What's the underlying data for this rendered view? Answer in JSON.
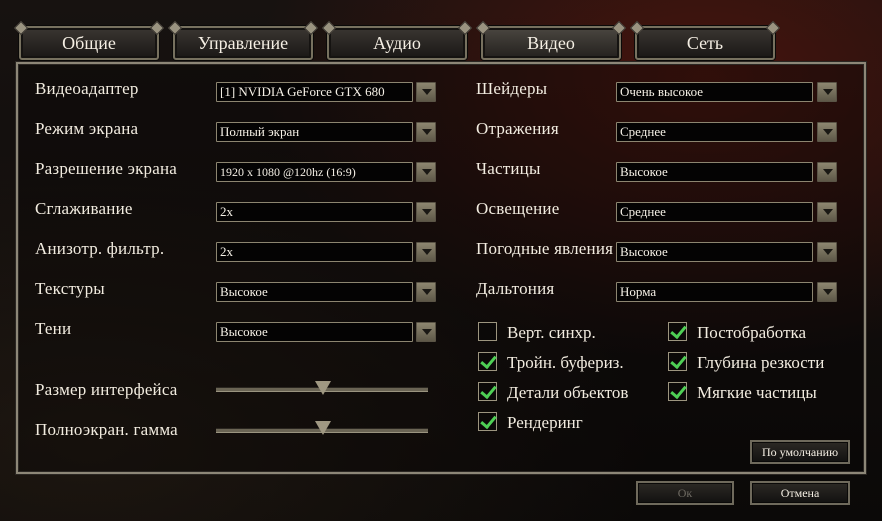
{
  "tabs": [
    {
      "label": "Общие"
    },
    {
      "label": "Управление"
    },
    {
      "label": "Аудио"
    },
    {
      "label": "Видео"
    },
    {
      "label": "Сеть"
    }
  ],
  "active_tab": "Видео",
  "left_settings": [
    {
      "label": "Видеоадаптер",
      "value": "[1] NVIDIA GeForce GTX 680"
    },
    {
      "label": "Режим экрана",
      "value": "Полный экран"
    },
    {
      "label": "Разрешение экрана",
      "value": "1920 x 1080 @120hz (16:9)"
    },
    {
      "label": "Сглаживание",
      "value": "2x"
    },
    {
      "label": "Анизотр. фильтр.",
      "value": "2x"
    },
    {
      "label": "Текстуры",
      "value": "Высокое"
    },
    {
      "label": "Тени",
      "value": "Высокое"
    }
  ],
  "right_settings": [
    {
      "label": "Шейдеры",
      "value": "Очень высокое"
    },
    {
      "label": "Отражения",
      "value": "Среднее"
    },
    {
      "label": "Частицы",
      "value": "Высокое"
    },
    {
      "label": "Освещение",
      "value": "Среднее"
    },
    {
      "label": "Погодные явления",
      "value": "Высокое"
    },
    {
      "label": "Дальтония",
      "value": "Норма"
    }
  ],
  "sliders": [
    {
      "label": "Размер интерфейса",
      "level": 0.5
    },
    {
      "label": "Полноэкран. гамма",
      "level": 0.5
    }
  ],
  "checkboxes": [
    {
      "label": "Верт. синхр.",
      "checked": false
    },
    {
      "label": "Тройн. буфериз.",
      "checked": true
    },
    {
      "label": "Детали объектов",
      "checked": true
    },
    {
      "label": "Рендеринг",
      "checked": true
    },
    {
      "label": "Постобработка",
      "checked": true
    },
    {
      "label": "Глубина резкости",
      "checked": true
    },
    {
      "label": "Мягкие частицы",
      "checked": true
    }
  ],
  "buttons": {
    "defaults": "По умолчанию",
    "ok": "Ок",
    "cancel": "Отмена"
  },
  "colors": {
    "check": "#4ecf55",
    "frame": "#8d8778"
  }
}
